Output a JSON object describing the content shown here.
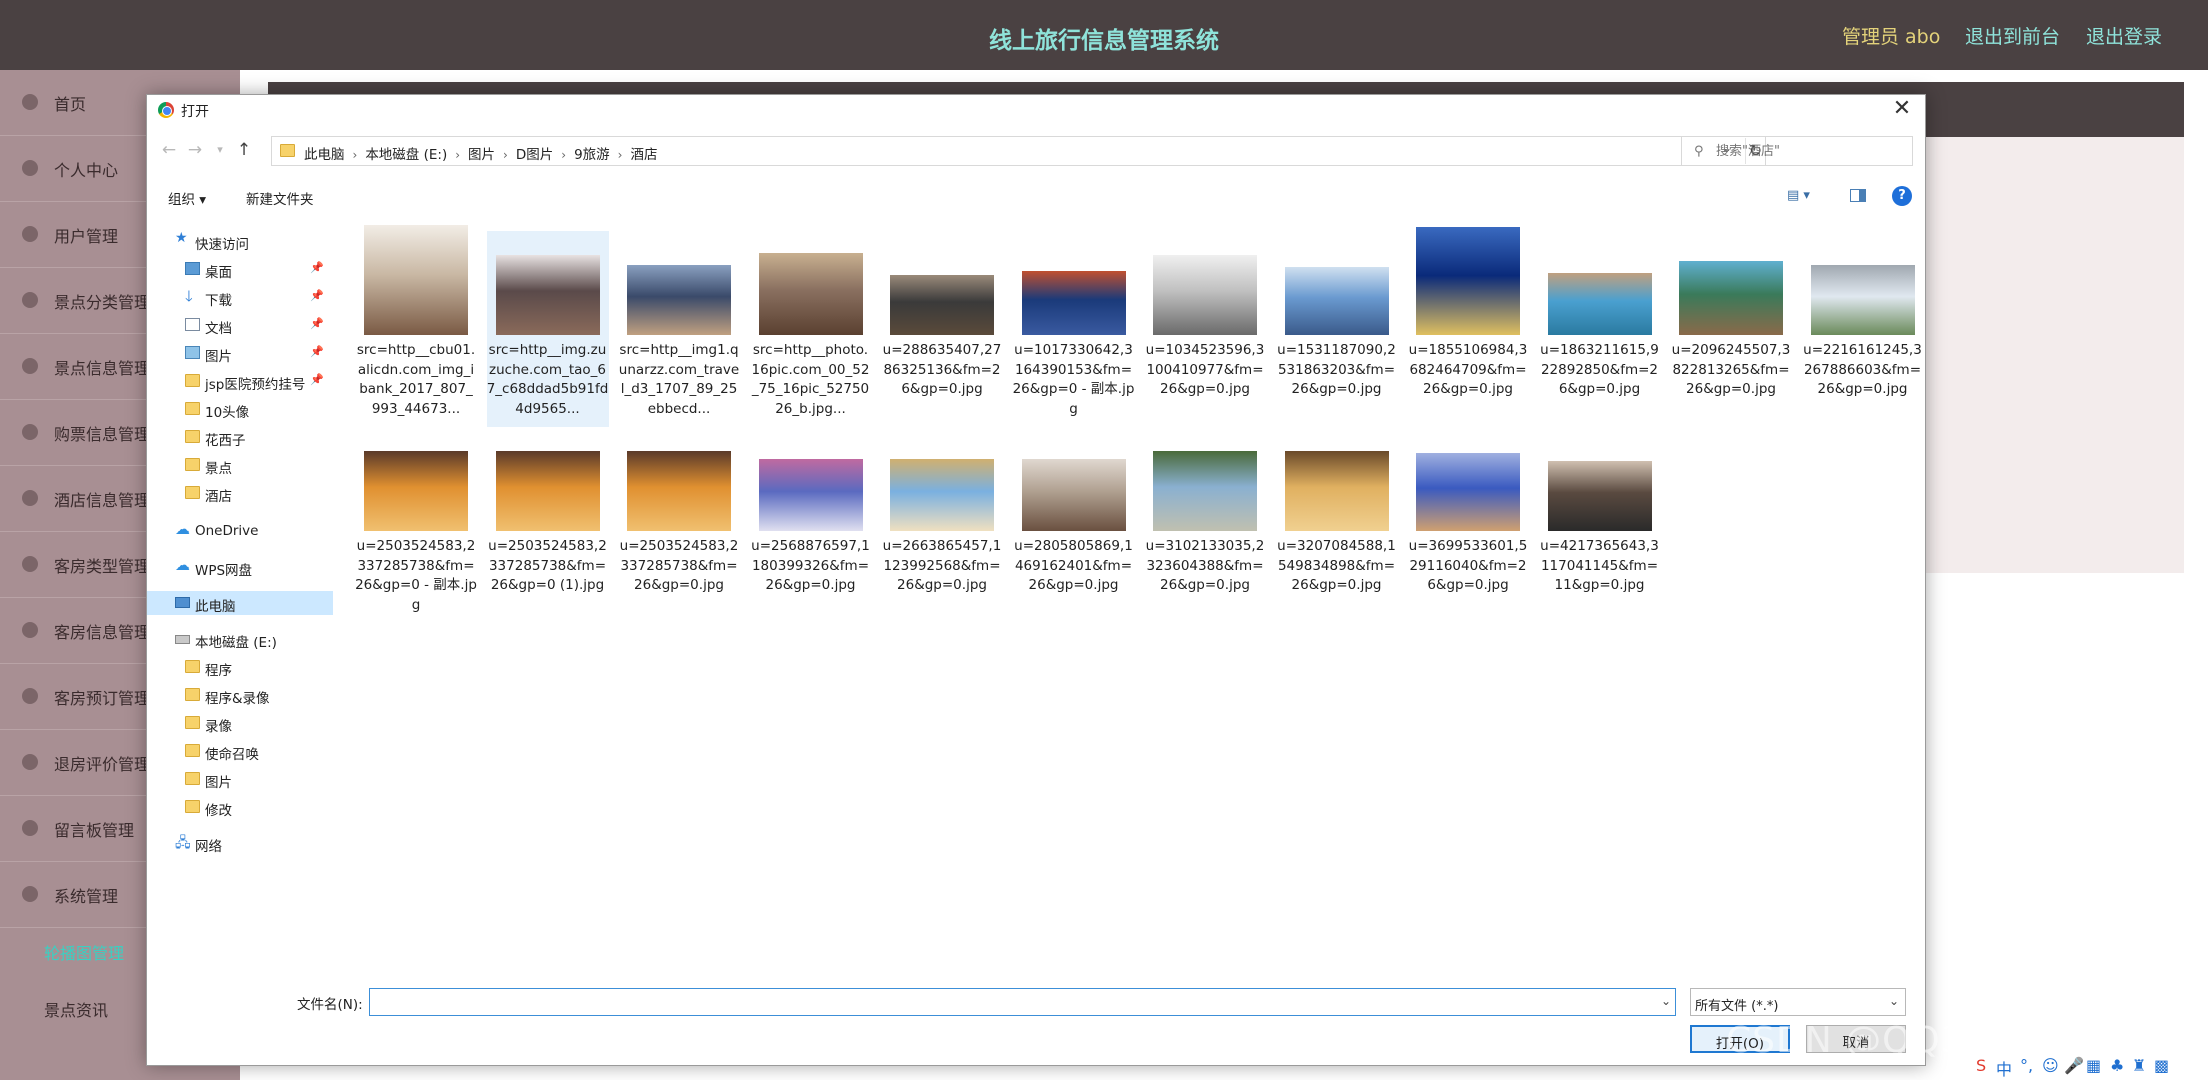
{
  "app": {
    "title": "线上旅行信息管理系统",
    "admin_label": "管理员 abo",
    "link_front": "退出到前台",
    "link_logout": "退出登录"
  },
  "sidebar": {
    "items": [
      {
        "label": "首页"
      },
      {
        "label": "个人中心"
      },
      {
        "label": "用户管理"
      },
      {
        "label": "景点分类管理"
      },
      {
        "label": "景点信息管理"
      },
      {
        "label": "购票信息管理"
      },
      {
        "label": "酒店信息管理"
      },
      {
        "label": "客房类型管理"
      },
      {
        "label": "客房信息管理"
      },
      {
        "label": "客房预订管理"
      },
      {
        "label": "退房评价管理"
      },
      {
        "label": "留言板管理"
      },
      {
        "label": "系统管理"
      }
    ],
    "subitems": [
      {
        "label": "轮播图管理"
      },
      {
        "label": "景点资讯"
      }
    ]
  },
  "dialog": {
    "title": "打开",
    "close_icon": "close-icon",
    "breadcrumbs": [
      "此电脑",
      "本地磁盘 (E:)",
      "图片",
      "D图片",
      "9旅游",
      "酒店"
    ],
    "search_placeholder": "搜索\"酒店\"",
    "toolbar": {
      "organize": "组织 ▾",
      "new_folder": "新建文件夹"
    },
    "nav": {
      "quick_access": "快速访问",
      "quick_items": [
        {
          "label": "桌面",
          "icon": "desktop-icon"
        },
        {
          "label": "下载",
          "icon": "download-icon"
        },
        {
          "label": "文档",
          "icon": "document-icon"
        },
        {
          "label": "图片",
          "icon": "pictures-icon"
        },
        {
          "label": "jsp医院预约挂号",
          "icon": "folder-icon"
        },
        {
          "label": "10头像",
          "icon": "folder-icon"
        },
        {
          "label": "花西子",
          "icon": "folder-icon"
        },
        {
          "label": "景点",
          "icon": "folder-icon"
        },
        {
          "label": "酒店",
          "icon": "folder-icon"
        }
      ],
      "onedrive": "OneDrive",
      "wps": "WPS网盘",
      "this_pc": "此电脑",
      "drive": "本地磁盘 (E:)",
      "drive_items": [
        {
          "label": "程序"
        },
        {
          "label": "程序&录像"
        },
        {
          "label": "录像"
        },
        {
          "label": "使命召唤"
        },
        {
          "label": "图片"
        },
        {
          "label": "修改"
        }
      ],
      "network": "网络"
    },
    "files": [
      {
        "caption": "src=http__cbu01.alicdn.com_img_ibank_2017_807_993_44673...",
        "colors": [
          "#c9b8a4",
          "#f2ede6",
          "#7a5a44"
        ]
      },
      {
        "caption": "src=http__img.zuzuche.com_tao_67_c68ddad5b91fd4d9565...",
        "colors": [
          "#5a4a4a",
          "#e8e2e2",
          "#8a6a5a"
        ]
      },
      {
        "caption": "src=http__img1.qunarzz.com_travel_d3_1707_89_25ebbecd...",
        "colors": [
          "#3a4a6a",
          "#8aa0c0",
          "#c0a080"
        ]
      },
      {
        "caption": "src=http__photo.16pic.com_00_52_75_16pic_5275026_b.jpg...",
        "colors": [
          "#8a7060",
          "#c8b090",
          "#5a4030"
        ]
      },
      {
        "caption": "u=288635407,2786325136&fm=26&gp=0.jpg",
        "colors": [
          "#3a3a3a",
          "#9a8a7a",
          "#5a4a3a"
        ]
      },
      {
        "caption": "u=1017330642,3164390153&fm=26&gp=0 - 副本.jpg",
        "colors": [
          "#1a3a7a",
          "#c05030",
          "#3a5aa0"
        ]
      },
      {
        "caption": "u=1034523596,3100410977&fm=26&gp=0.jpg",
        "colors": [
          "#c0c0c0",
          "#f0f0f0",
          "#6a6a6a"
        ]
      },
      {
        "caption": "u=1531187090,2531863203&fm=26&gp=0.jpg",
        "colors": [
          "#6a9ad0",
          "#d0e0f0",
          "#3a5a8a"
        ]
      },
      {
        "caption": "u=1855106984,3682464709&fm=26&gp=0.jpg",
        "colors": [
          "#0a2a7a",
          "#3a6ac0",
          "#e0c060"
        ]
      },
      {
        "caption": "u=1863211615,922892850&fm=26&gp=0.jpg",
        "colors": [
          "#4aa0d0",
          "#c0a080",
          "#2a7aa0"
        ]
      },
      {
        "caption": "u=2096245507,3822813265&fm=26&gp=0.jpg",
        "colors": [
          "#3a7a5a",
          "#60b0d0",
          "#8a6a4a"
        ]
      },
      {
        "caption": "u=2216161245,3267886603&fm=26&gp=0.jpg",
        "colors": [
          "#e0e8f0",
          "#a0a8b0",
          "#6a8a5a"
        ]
      },
      {
        "caption": "u=2503524583,2337285738&fm=26&gp=0 - 副本.jpg",
        "colors": [
          "#e09030",
          "#5a3a2a",
          "#f0c070"
        ]
      },
      {
        "caption": "u=2503524583,2337285738&fm=26&gp=0 (1).jpg",
        "colors": [
          "#e09030",
          "#5a3a2a",
          "#f0c070"
        ]
      },
      {
        "caption": "u=2503524583,2337285738&fm=26&gp=0.jpg",
        "colors": [
          "#e09030",
          "#5a3a2a",
          "#f0c070"
        ]
      },
      {
        "caption": "u=2568876597,1180399326&fm=26&gp=0.jpg",
        "colors": [
          "#5a6ac0",
          "#c06aa0",
          "#e0e0f0"
        ]
      },
      {
        "caption": "u=2663865457,1123992568&fm=26&gp=0.jpg",
        "colors": [
          "#7ab0e0",
          "#d0b070",
          "#f0e0c0"
        ]
      },
      {
        "caption": "u=2805805869,1469162401&fm=26&gp=0.jpg",
        "colors": [
          "#b0a090",
          "#e0d8d0",
          "#6a5040"
        ]
      },
      {
        "caption": "u=3102133035,2323604388&fm=26&gp=0.jpg",
        "colors": [
          "#8ab0d0",
          "#4a6a3a",
          "#c0c0b0"
        ]
      },
      {
        "caption": "u=3207084588,1549834898&fm=26&gp=0.jpg",
        "colors": [
          "#e0b060",
          "#6a4a2a",
          "#f0d090"
        ]
      },
      {
        "caption": "u=3699533601,529116040&fm=26&gp=0.jpg",
        "colors": [
          "#3a5ac0",
          "#a0b0e0",
          "#d0a070"
        ]
      },
      {
        "caption": "u=4217365643,3117041145&fm=11&gp=0.jpg",
        "colors": [
          "#5a4a40",
          "#d0c0b0",
          "#2a2a2a"
        ]
      }
    ],
    "filename_label": "文件名(N):",
    "filename_value": "",
    "filetype": "所有文件 (*.*)",
    "open_button": "打开(O)",
    "cancel_button": "取消"
  },
  "watermark": "CSDN @QQ3295391197"
}
